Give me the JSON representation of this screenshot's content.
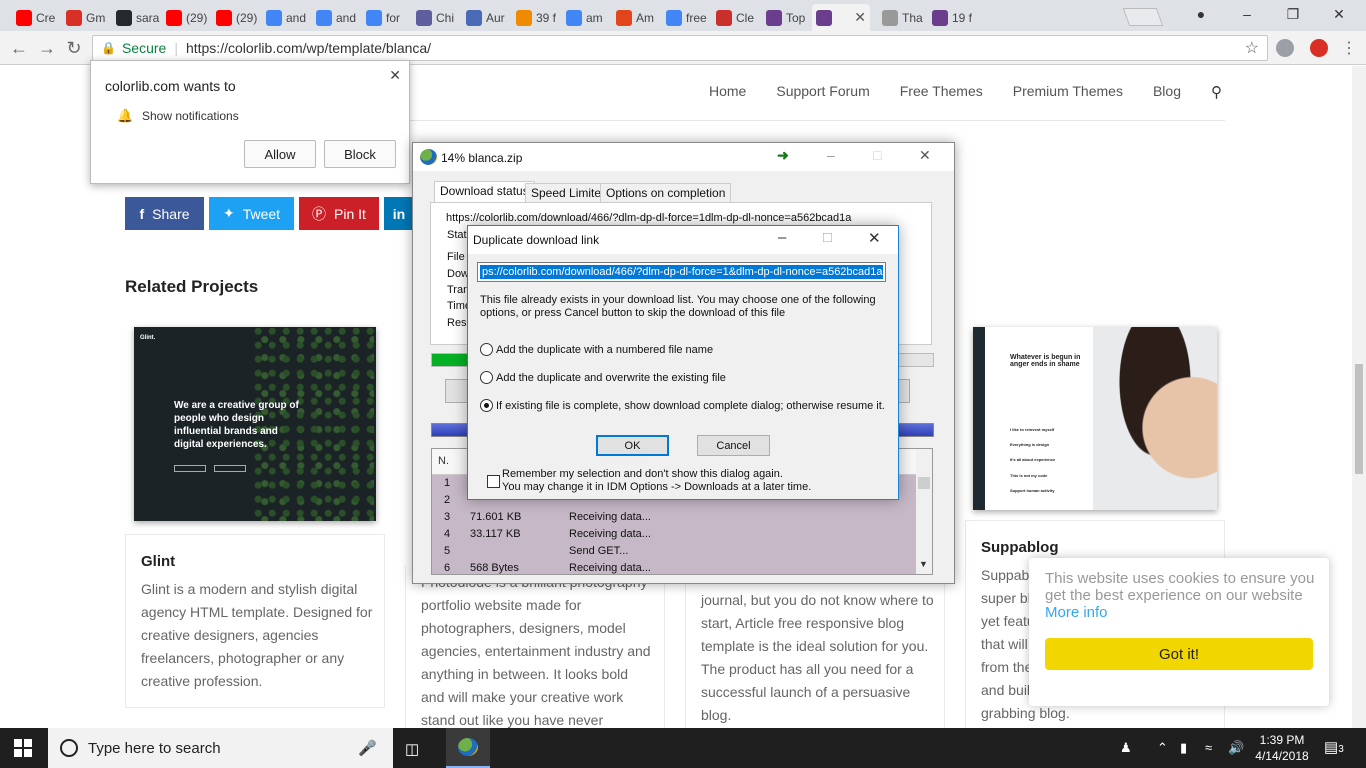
{
  "browser": {
    "tabs": [
      {
        "label": "Cre",
        "icon": "youtube-icon",
        "color": "#ff0000"
      },
      {
        "label": "Gm",
        "icon": "gmail-icon",
        "color": "#d93025"
      },
      {
        "label": "sara",
        "icon": "github-icon",
        "color": "#24292e"
      },
      {
        "label": "(29)",
        "icon": "youtube-icon",
        "color": "#ff0000"
      },
      {
        "label": "(29)",
        "icon": "youtube-icon",
        "color": "#ff0000"
      },
      {
        "label": "and",
        "icon": "google-icon",
        "color": "#4285f4"
      },
      {
        "label": "and",
        "icon": "google-icon",
        "color": "#4285f4"
      },
      {
        "label": "for",
        "icon": "google-icon",
        "color": "#4285f4"
      },
      {
        "label": "Chi",
        "icon": "compass-icon",
        "color": "#5e5e9e"
      },
      {
        "label": "Aur",
        "icon": "s-icon",
        "color": "#4a6ab5"
      },
      {
        "label": "39 f",
        "icon": "her-icon",
        "color": "#f08a00"
      },
      {
        "label": "am",
        "icon": "google-icon",
        "color": "#4285f4"
      },
      {
        "label": "Am",
        "icon": "flame-icon",
        "color": "#e0451b"
      },
      {
        "label": "free",
        "icon": "google-icon",
        "color": "#4285f4"
      },
      {
        "label": "Cle",
        "icon": "s-red-icon",
        "color": "#c9302c"
      },
      {
        "label": "Top",
        "icon": "colorlib-icon",
        "color": "#6b3d8d"
      },
      {
        "label": "",
        "icon": "colorlib-icon",
        "color": "#6b3d8d",
        "active": true
      },
      {
        "label": "Tha",
        "icon": "loading-icon",
        "color": "#999999"
      },
      {
        "label": "19 f",
        "icon": "colorlib-icon",
        "color": "#6b3d8d"
      }
    ],
    "secure_label": "Secure",
    "url": "https://colorlib.com/wp/template/blanca/"
  },
  "site": {
    "nav": [
      "Home",
      "Support Forum",
      "Free Themes",
      "Premium Themes",
      "Blog"
    ],
    "share": [
      {
        "label": "Share",
        "icon": "f",
        "color": "#3b5998"
      },
      {
        "label": "Tweet",
        "icon": "t",
        "color": "#1da1f2"
      },
      {
        "label": "Pin It",
        "icon": "p",
        "color": "#cb2027"
      },
      {
        "label": "in",
        "icon": "",
        "color": "#0077b5"
      }
    ],
    "related_title": "Related Projects",
    "glint": {
      "logo": "Glint.",
      "headline": "We are a creative group of people who design influential brands and digital experiences.",
      "title": "Glint",
      "desc": "Glint is a modern and stylish digital agency HTML template. Designed for creative designers, agencies freelancers, photographer or any creative profession."
    },
    "photo_desc": "Photodiode is a brilliant photography portfolio website made for photographers, designers, model agencies, entertainment industry and anything in between.  It looks bold and will make your creative work stand out like you have never",
    "article_desc": "journal, but you do not know where to start, Article free responsive blog template is the ideal solution for you. The product has all you need for a successful launch of a persuasive blog.",
    "suppablog": {
      "headline": "Whatever is begun in anger ends in shame",
      "items": [
        "I like to reinvent myself",
        "Everything is design",
        "It's all about experience",
        "This is not my code",
        "Support human activity"
      ],
      "title": "Suppablog",
      "desc_lines": [
        "Suppab",
        "super bl",
        "yet featu",
        "that will",
        "from the",
        "and buil",
        "grabbing blog."
      ]
    }
  },
  "notification": {
    "title": "colorlib.com wants to",
    "row": "Show notifications",
    "allow": "Allow",
    "block": "Block"
  },
  "idm": {
    "title": "14% blanca.zip",
    "tabs": [
      "Download status",
      "Speed Limiter",
      "Options on completion"
    ],
    "url": "https://colorlib.com/download/466/?dlm-dp-dl-force=1dlm-dp-dl-nonce=a562bcad1a",
    "labels": [
      "Statu",
      "File s",
      "Dow",
      "Tran",
      "Time",
      "Resu"
    ],
    "progress_fraction": 0.14,
    "table_header": "N.",
    "rows": [
      {
        "n": "1",
        "size": "",
        "info": ""
      },
      {
        "n": "2",
        "size": "",
        "info": ""
      },
      {
        "n": "3",
        "size": "71.601  KB",
        "info": "Receiving data..."
      },
      {
        "n": "4",
        "size": "33.117  KB",
        "info": "Receiving data..."
      },
      {
        "n": "5",
        "size": "",
        "info": "Send GET..."
      },
      {
        "n": "6",
        "size": "568  Bytes",
        "info": "Receiving data..."
      }
    ]
  },
  "duplicate": {
    "title": "Duplicate download link",
    "url": "ps://colorlib.com/download/466/?dlm-dp-dl-force=1&dlm-dp-dl-nonce=a562bcad1a",
    "message": "This file already exists in your download list. You may choose one of the following options, or press Cancel button to skip the download of this file",
    "options": [
      {
        "label": "Add the duplicate with a numbered file name",
        "selected": false
      },
      {
        "label": "Add the duplicate and overwrite the existing file",
        "selected": false
      },
      {
        "label": "If existing file is complete, show download complete dialog; otherwise resume it.",
        "selected": true
      }
    ],
    "ok": "OK",
    "cancel": "Cancel",
    "remember_line1": "Remember my selection and don't show this dialog again.",
    "remember_line2": "You may change it in IDM Options -> Downloads at a later time."
  },
  "cookie": {
    "text": "This website uses cookies to ensure you get the best experience on our website",
    "link": "More info",
    "button": "Got it!"
  },
  "taskbar": {
    "search_placeholder": "Type here to search",
    "time": "1:39 PM",
    "date": "4/14/2018",
    "notifications": "3"
  }
}
